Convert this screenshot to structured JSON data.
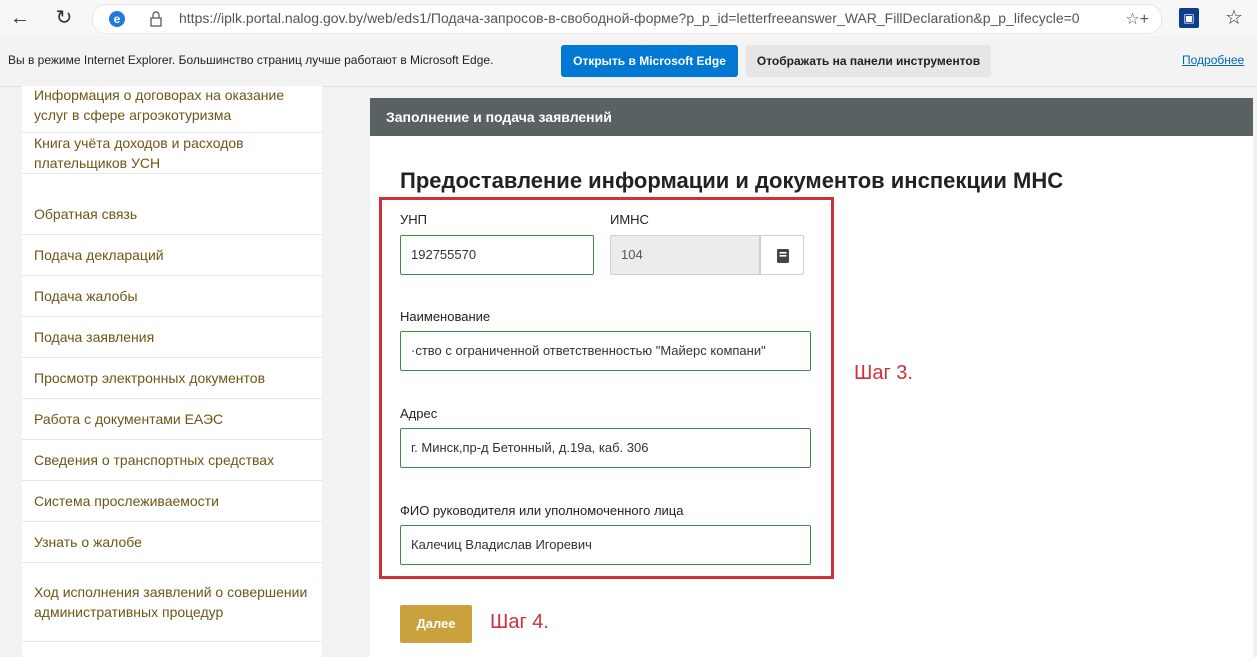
{
  "browser": {
    "url": "https://iplk.portal.nalog.gov.by/web/eds1/Подача-запросов-в-свободной-форме?p_p_id=letterfreeanswer_WAR_FillDeclaration&p_p_lifecycle=0",
    "icons": [
      "back-icon",
      "refresh-icon",
      "ie-icon",
      "lock-icon",
      "favorites-add-icon",
      "extension-icon",
      "favorites-icon"
    ]
  },
  "ie_bar": {
    "message": "Вы в режиме Internet Explorer. Большинство страниц лучше работают в Microsoft Edge.",
    "open_edge_label": "Открыть в Microsoft Edge",
    "pin_label": "Отображать на панели инструментов",
    "more_label": "Подробнее"
  },
  "sidebar": {
    "items": [
      {
        "label": "Информация о договорах на оказание услуг в сфере агроэкотуризма"
      },
      {
        "label": "Книга учёта доходов и расходов плательщиков УСН"
      },
      {
        "label": "Обратная связь"
      },
      {
        "label": "Подача деклараций"
      },
      {
        "label": "Подача жалобы"
      },
      {
        "label": "Подача заявления"
      },
      {
        "label": "Просмотр электронных документов"
      },
      {
        "label": "Работа с документами ЕАЭС"
      },
      {
        "label": "Сведения о транспортных средствах"
      },
      {
        "label": "Система прослеживаемости"
      },
      {
        "label": "Узнать о жалобе"
      },
      {
        "label": "Ход исполнения заявлений о совершении административных процедур"
      }
    ]
  },
  "panel": {
    "header": "Заполнение и подача заявлений",
    "title": "Предоставление информации и документов инспекции МНС",
    "unp_label": "УНП",
    "unp_value": "192755570",
    "imns_label": "ИМНС",
    "imns_value": "104",
    "name_label": "Наименование",
    "name_value": "·ство с ограниченной ответственностью \"Майерс компани\"",
    "address_label": "Адрес",
    "address_value": "г. Минск,пр-д Бетонный, д.19а, каб. 306",
    "head_label": "ФИО руководителя или уполномоченного лица",
    "head_value": "Калечиц Владислав Игоревич",
    "next_label": "Далее"
  },
  "annotations": {
    "step3": "Шаг 3.",
    "step4": "Шаг 4.",
    "accent_color": "#d0303a"
  }
}
